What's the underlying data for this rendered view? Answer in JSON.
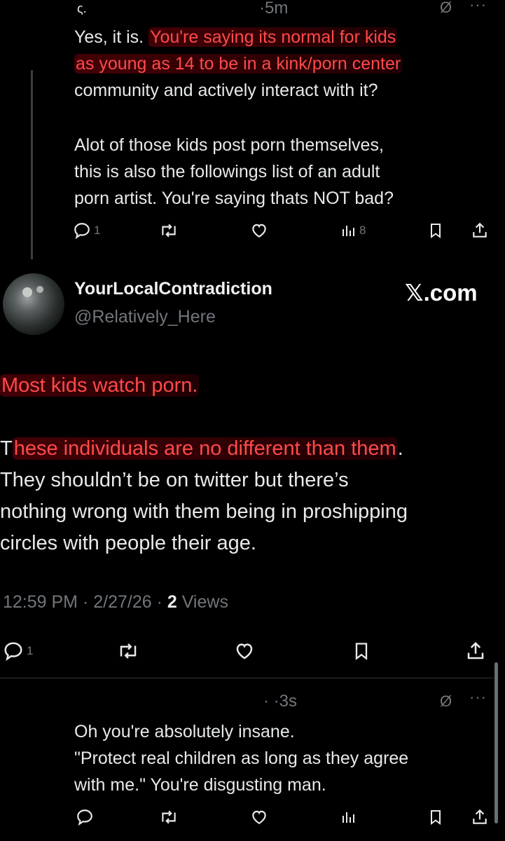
{
  "reply_top": {
    "author_partial": "ς.",
    "time": "·5m",
    "grok_icon": "Ø",
    "more_icon": "···",
    "line1_plain": "Yes, it is. ",
    "line1_highlight": "You're saying its normal for kids",
    "line2_highlight": "as young as 14 to be in a kink/porn center",
    "line3": "community and actively interact with it?",
    "para2": [
      "Alot of those kids post porn themselves,",
      "this is also the followings list of an adult",
      "porn artist. You're saying thats NOT bad?"
    ],
    "actions": {
      "replies": "1",
      "reposts": "",
      "likes": "",
      "views": "8"
    }
  },
  "main_tweet": {
    "display_name": "YourLocalContradiction",
    "handle": "@Relatively_Here",
    "watermark": "𝕏.com",
    "p1": "Most kids watch porn.",
    "p2_first": "T",
    "p2_highlight": "hese individuals are no different than them",
    "p2_end": ".",
    "p2_rest": [
      "They shouldn’t be on twitter but there’s",
      "nothing wrong with them being in proshipping",
      "circles with people their age."
    ],
    "timestamp": "12:59 PM · 2/27/26 · ",
    "views_count": "2",
    "views_label": " Views",
    "actions": {
      "replies": "1"
    }
  },
  "reply_bottom": {
    "time": "· ·3s",
    "grok_icon": "Ø",
    "more_icon": "···",
    "lines": [
      "Oh you're absolutely insane.",
      "\"Protect real children as long as they agree",
      "with me.\" You're disgusting man."
    ]
  },
  "colors": {
    "background": "#000000",
    "text": "#e7e9ea",
    "muted": "#71767b",
    "highlight_red": "#ff4a4a"
  }
}
